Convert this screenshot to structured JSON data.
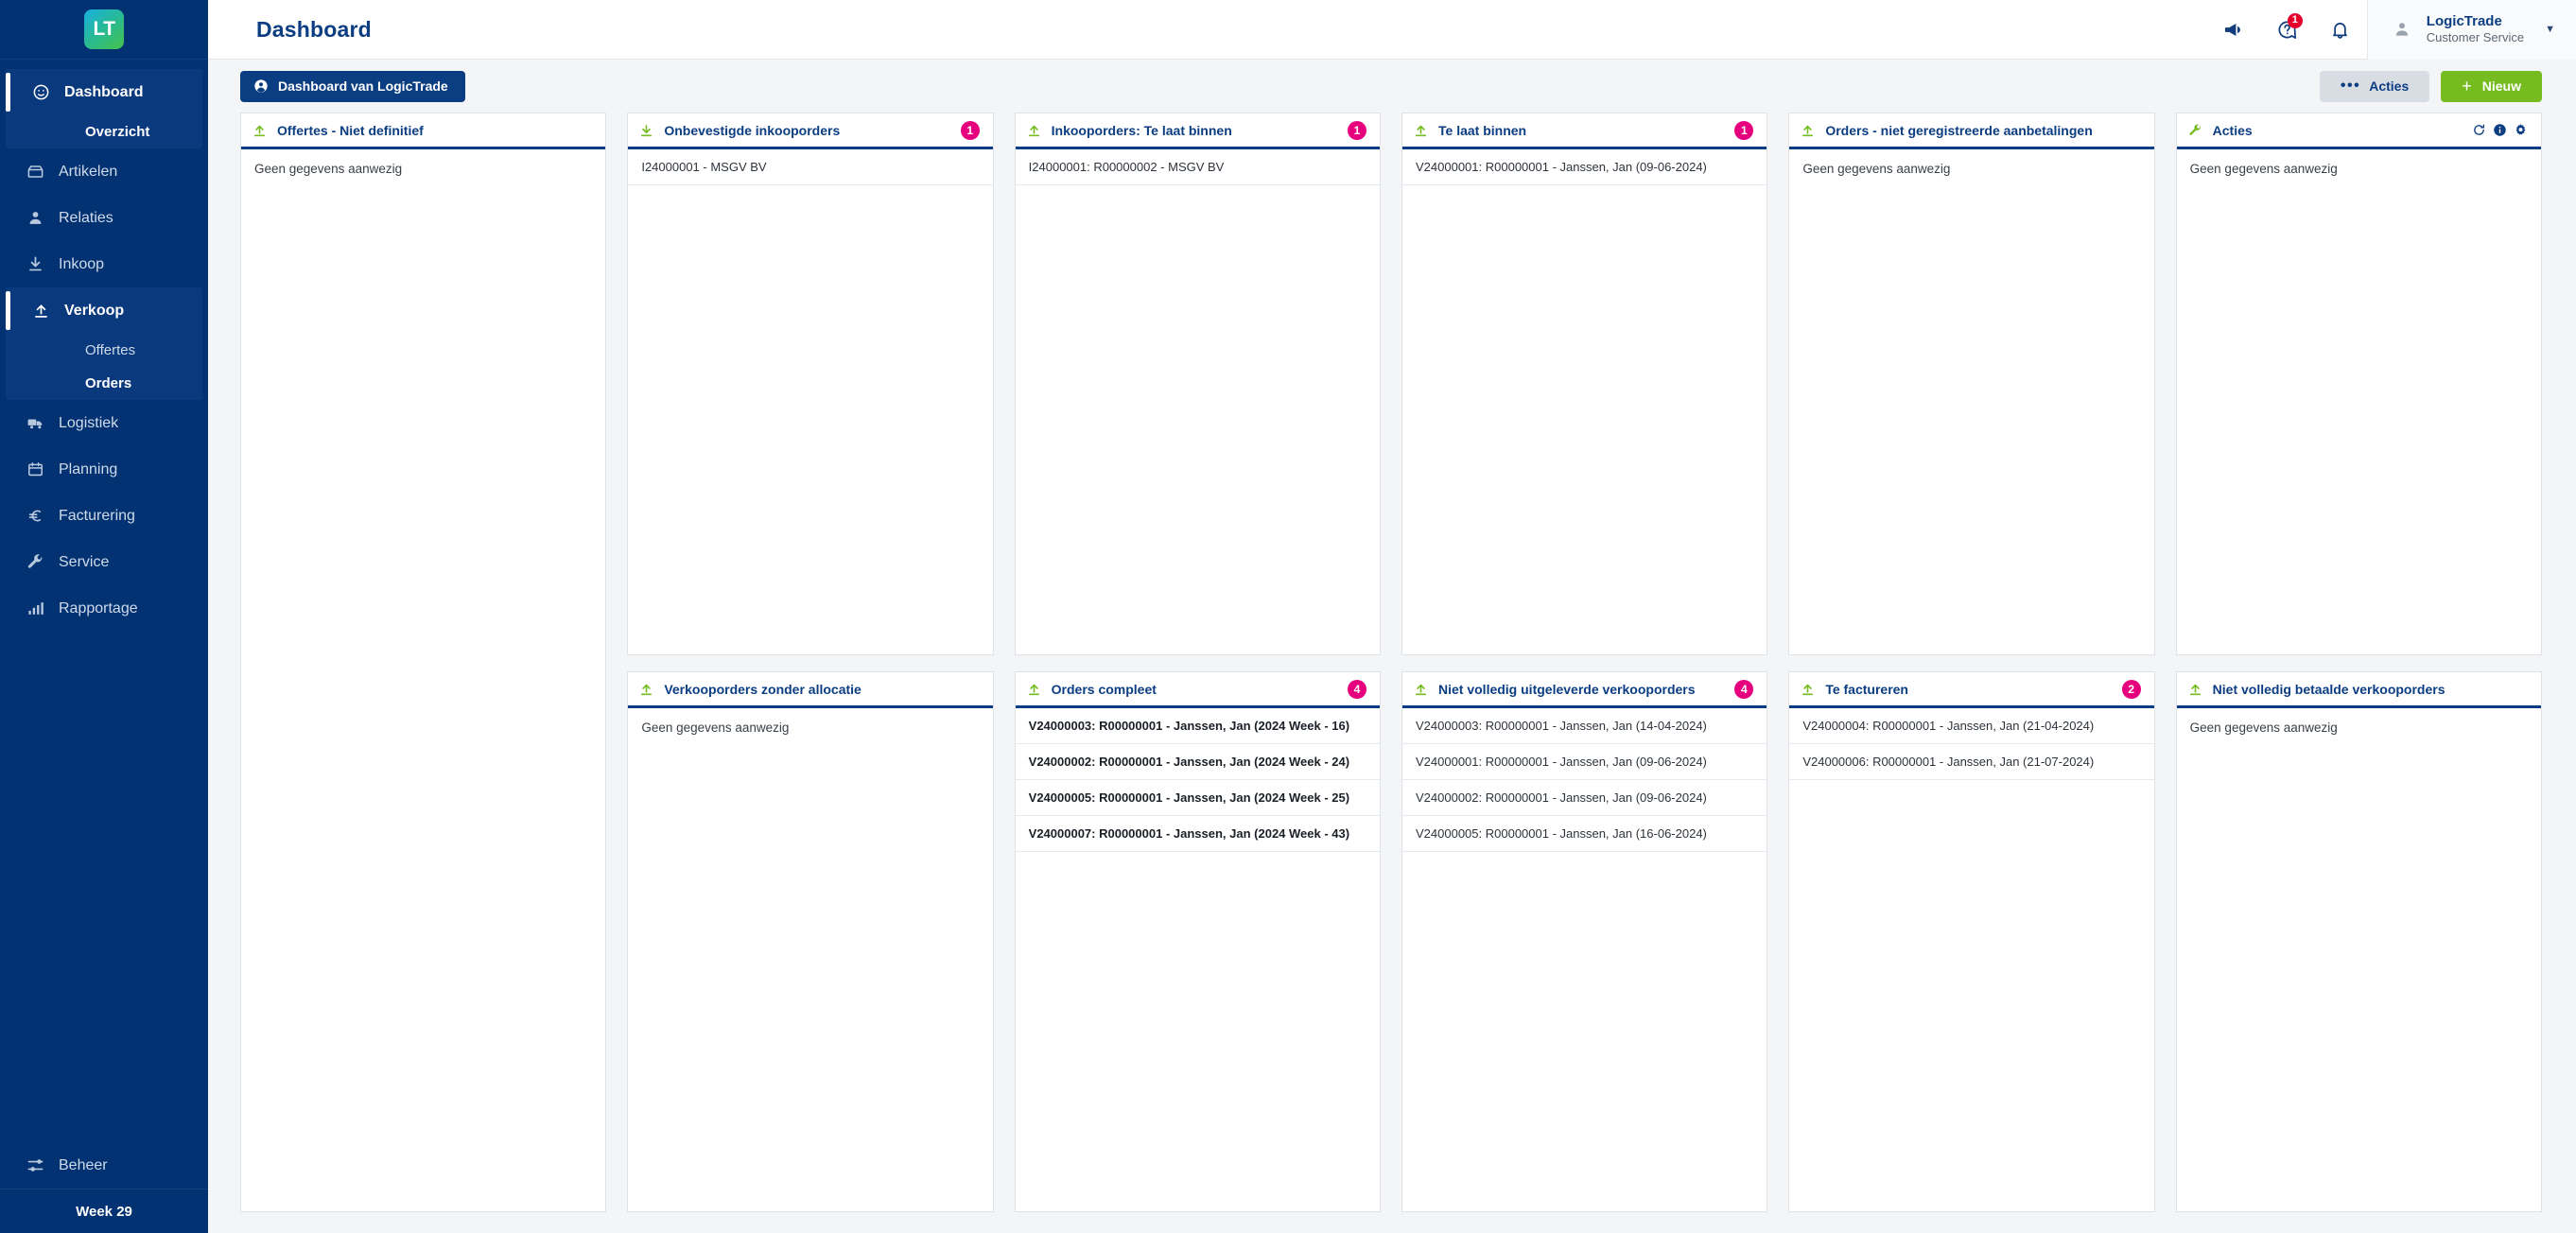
{
  "brand": {
    "logo_text": "LT",
    "accent_green": "#76bc21",
    "accent_pink": "#e6007e",
    "primary_blue": "#0b3d82",
    "sidebar_blue": "#023272"
  },
  "sidebar": {
    "items": [
      {
        "label": "Dashboard",
        "icon": "dashboard-icon",
        "active": true
      },
      {
        "label": "Overzicht",
        "icon": "",
        "sub": true
      },
      {
        "label": "Artikelen",
        "icon": "box-icon"
      },
      {
        "label": "Relaties",
        "icon": "user-icon"
      },
      {
        "label": "Inkoop",
        "icon": "download-arrow-icon"
      },
      {
        "label": "Verkoop",
        "icon": "upload-arrow-icon",
        "active": true
      },
      {
        "label": "Offertes",
        "sub": true
      },
      {
        "label": "Orders",
        "sub": true
      },
      {
        "label": "Logistiek",
        "icon": "truck-icon"
      },
      {
        "label": "Planning",
        "icon": "calendar-icon"
      },
      {
        "label": "Facturering",
        "icon": "euro-icon"
      },
      {
        "label": "Service",
        "icon": "wrench-icon"
      },
      {
        "label": "Rapportage",
        "icon": "bar-chart-icon"
      }
    ],
    "beheer_label": "Beheer",
    "week_label": "Week 29"
  },
  "header": {
    "title": "Dashboard",
    "icons": [
      {
        "name": "megaphone-icon",
        "badge": null
      },
      {
        "name": "help-circle-icon",
        "badge": "1"
      },
      {
        "name": "bell-icon",
        "badge": null
      }
    ],
    "user": {
      "name": "LogicTrade",
      "role": "Customer Service"
    }
  },
  "actionbar": {
    "dashboard_button": "Dashboard van LogicTrade",
    "acties_button": "Acties",
    "nieuw_button": "Nieuw"
  },
  "widgets": [
    {
      "title": "Offertes - Niet definitief",
      "icon": "upload-arrow-icon",
      "badge": null,
      "tall": true,
      "empty_text": "Geen gegevens aanwezig",
      "rows": []
    },
    {
      "title": "Onbevestigde inkooporders",
      "icon": "download-arrow-icon",
      "badge": "1",
      "empty_text": null,
      "rows": [
        {
          "text": "I24000001 - MSGV BV",
          "bold": false
        }
      ]
    },
    {
      "title": "Inkooporders: Te laat binnen",
      "icon": "upload-arrow-icon",
      "badge": "1",
      "empty_text": null,
      "rows": [
        {
          "text": "I24000001: R00000002 - MSGV BV",
          "bold": false
        }
      ]
    },
    {
      "title": "Te laat binnen",
      "icon": "upload-arrow-icon",
      "badge": "1",
      "empty_text": null,
      "rows": [
        {
          "text": "V24000001: R00000001 - Janssen, Jan (09-06-2024)",
          "bold": false
        }
      ]
    },
    {
      "title": "Orders - niet geregistreerde aanbetalingen",
      "icon": "upload-arrow-icon",
      "badge": null,
      "empty_text": "Geen gegevens aanwezig",
      "rows": []
    },
    {
      "title": "Acties",
      "icon": "wrench-icon",
      "badge": null,
      "tools": [
        "refresh-icon",
        "info-icon",
        "gear-icon"
      ],
      "empty_text": "Geen gegevens aanwezig",
      "rows": []
    },
    {
      "title": "Verkooporders zonder allocatie",
      "icon": "upload-arrow-icon",
      "badge": null,
      "empty_text": "Geen gegevens aanwezig",
      "rows": []
    },
    {
      "title": "Orders compleet",
      "icon": "upload-arrow-icon",
      "badge": "4",
      "empty_text": null,
      "rows": [
        {
          "text": "V24000003: R00000001 - Janssen, Jan (2024 Week - 16)",
          "bold": true
        },
        {
          "text": "V24000002: R00000001 - Janssen, Jan (2024 Week - 24)",
          "bold": true
        },
        {
          "text": "V24000005: R00000001 - Janssen, Jan (2024 Week - 25)",
          "bold": true
        },
        {
          "text": "V24000007: R00000001 - Janssen, Jan (2024 Week - 43)",
          "bold": true
        }
      ]
    },
    {
      "title": "Niet volledig uitgeleverde verkooporders",
      "icon": "upload-arrow-icon",
      "badge": "4",
      "empty_text": null,
      "rows": [
        {
          "text": "V24000003: R00000001 - Janssen, Jan (14-04-2024)",
          "bold": false
        },
        {
          "text": "V24000001: R00000001 - Janssen, Jan (09-06-2024)",
          "bold": false
        },
        {
          "text": "V24000002: R00000001 - Janssen, Jan (09-06-2024)",
          "bold": false
        },
        {
          "text": "V24000005: R00000001 - Janssen, Jan (16-06-2024)",
          "bold": false
        }
      ]
    },
    {
      "title": "Te factureren",
      "icon": "upload-arrow-icon",
      "badge": "2",
      "empty_text": null,
      "rows": [
        {
          "text": "V24000004: R00000001 - Janssen, Jan (21-04-2024)",
          "bold": false
        },
        {
          "text": "V24000006: R00000001 - Janssen, Jan (21-07-2024)",
          "bold": false
        }
      ]
    },
    {
      "title": "Niet volledig betaalde verkooporders",
      "icon": "upload-arrow-icon",
      "badge": null,
      "empty_text": "Geen gegevens aanwezig",
      "rows": []
    }
  ]
}
